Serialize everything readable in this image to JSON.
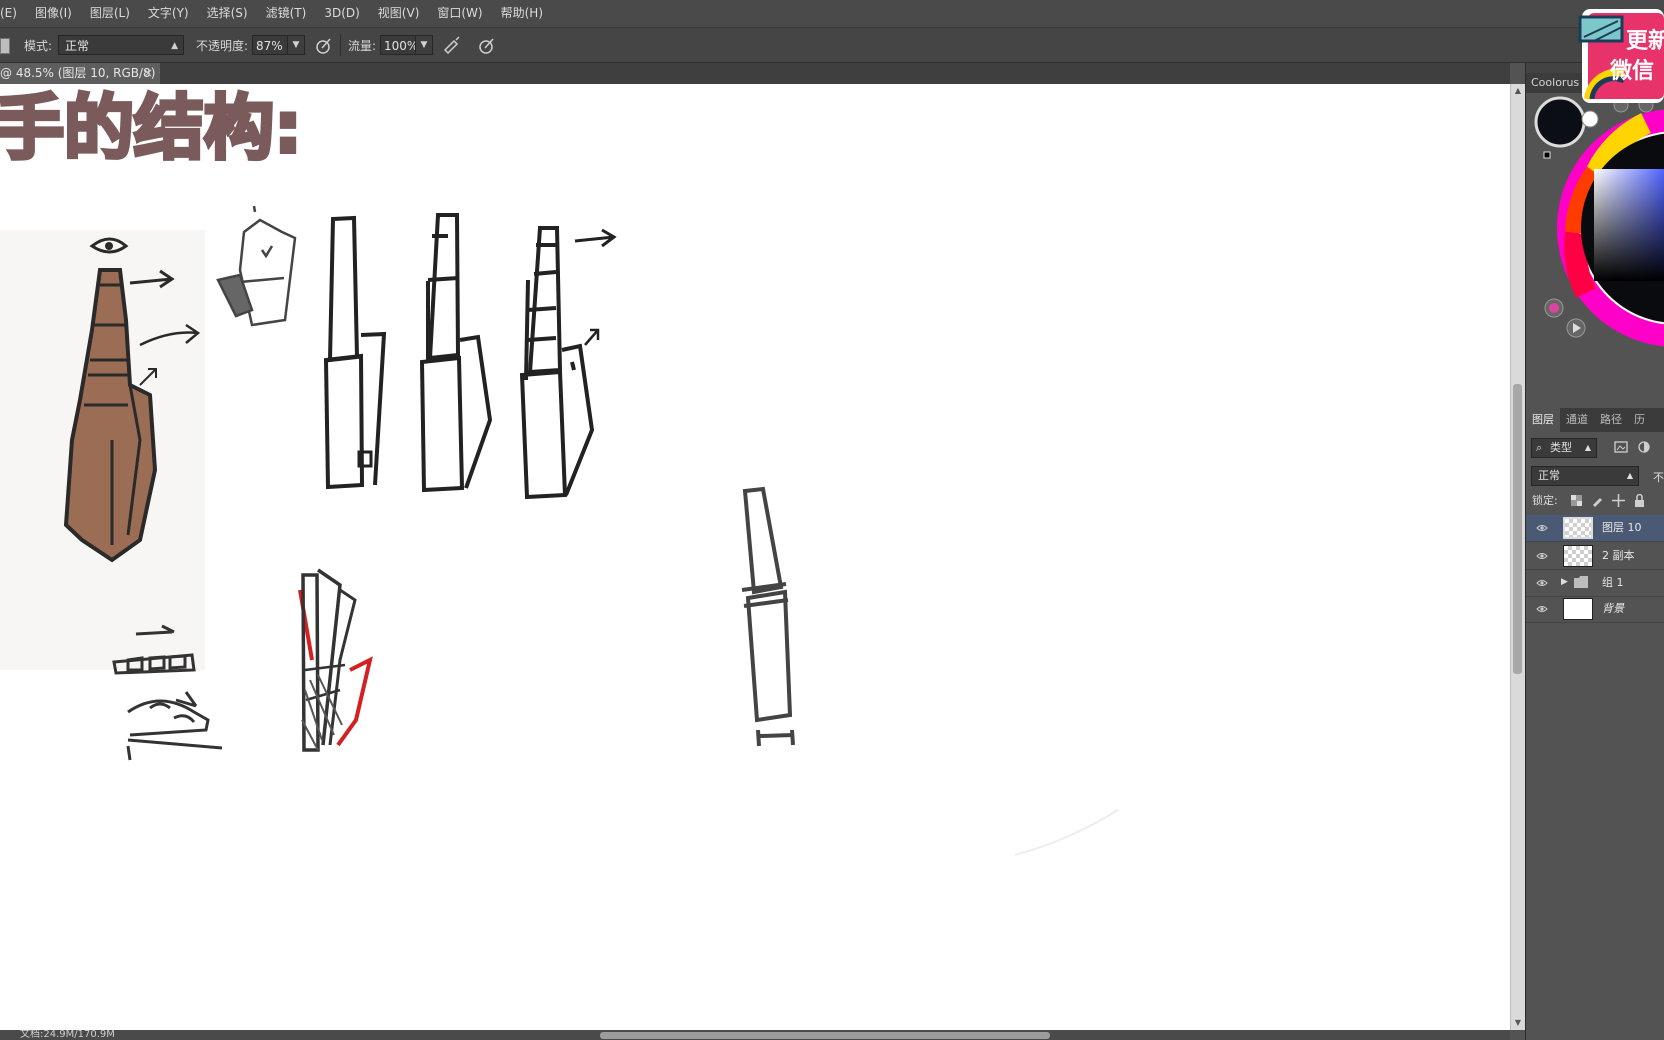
{
  "menubar": {
    "items": [
      "(E)",
      "图像(I)",
      "图层(L)",
      "文字(Y)",
      "选择(S)",
      "滤镜(T)",
      "3D(D)",
      "视图(V)",
      "窗口(W)",
      "帮助(H)"
    ]
  },
  "options": {
    "mode_label": "模式:",
    "mode_value": "正常",
    "opacity_label": "不透明度:",
    "opacity_value": "87%",
    "flow_label": "流量:",
    "flow_value": "100%"
  },
  "document": {
    "tab_title": "@ 48.5% (图层 10, RGB/8) *",
    "close_glyph": "×",
    "canvas_title": "手的结构:",
    "status_text": "文档:24.9M/170.9M"
  },
  "coolorus": {
    "title": "Coolorus",
    "current_color": "#0b0e14"
  },
  "layers_panel": {
    "tabs": [
      "图层",
      "通道",
      "路径",
      "历"
    ],
    "filter_label": "类型",
    "blend_mode": "正常",
    "opacity_short": "不",
    "lock_label": "锁定:",
    "layers": [
      {
        "name": "图层 10",
        "thumb": "checker",
        "selected": true,
        "type": "layer"
      },
      {
        "name": "2 副本",
        "thumb": "checker",
        "selected": false,
        "type": "layer"
      },
      {
        "name": "组 1",
        "thumb": "folder",
        "selected": false,
        "type": "group"
      },
      {
        "name": "背景",
        "thumb": "white",
        "selected": false,
        "type": "background"
      }
    ]
  },
  "promo": {
    "line1": "更新",
    "line2": "微信",
    "bg_color": "#e8336a"
  },
  "colors": {
    "accent_selected": "#4b5a74",
    "title_text": "#7a5a5a",
    "sketch_red": "#d42020"
  }
}
